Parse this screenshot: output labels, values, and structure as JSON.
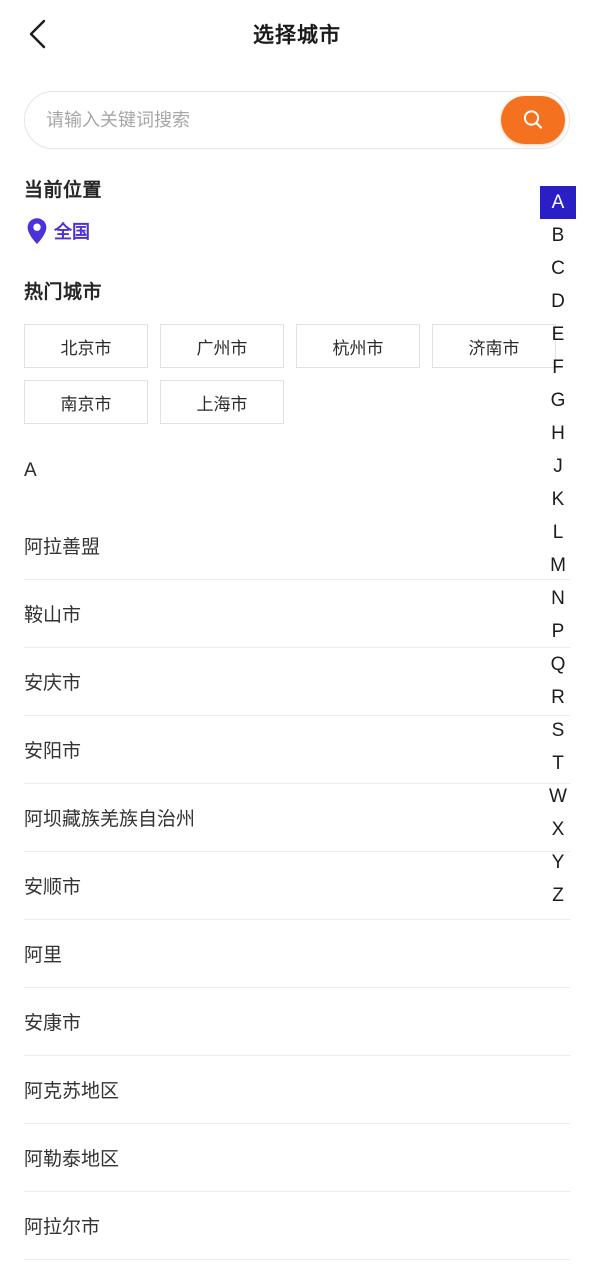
{
  "header": {
    "title": "选择城市",
    "back_icon": "chevron-left-icon"
  },
  "search": {
    "placeholder": "请输入关键词搜索",
    "value": "",
    "button_icon": "search-icon",
    "button_color": "#f4711f"
  },
  "current_location": {
    "section_title": "当前位置",
    "pin_icon": "location-pin-icon",
    "name": "全国",
    "color": "#4b32d8"
  },
  "hot_cities": {
    "section_title": "热门城市",
    "items": [
      {
        "label": "北京市"
      },
      {
        "label": "广州市"
      },
      {
        "label": "杭州市"
      },
      {
        "label": "济南市"
      },
      {
        "label": "南京市"
      },
      {
        "label": "上海市"
      }
    ]
  },
  "city_sections": [
    {
      "letter": "A",
      "cities": [
        {
          "name": "阿拉善盟"
        },
        {
          "name": "鞍山市"
        },
        {
          "name": "安庆市"
        },
        {
          "name": "安阳市"
        },
        {
          "name": "阿坝藏族羌族自治州"
        },
        {
          "name": "安顺市"
        },
        {
          "name": "阿里"
        },
        {
          "name": "安康市"
        },
        {
          "name": "阿克苏地区"
        },
        {
          "name": "阿勒泰地区"
        },
        {
          "name": "阿拉尔市"
        }
      ]
    }
  ],
  "index_bar": {
    "active": "A",
    "active_color": "#2a1fc4",
    "letters": [
      "A",
      "B",
      "C",
      "D",
      "E",
      "F",
      "G",
      "H",
      "J",
      "K",
      "L",
      "M",
      "N",
      "P",
      "Q",
      "R",
      "S",
      "T",
      "W",
      "X",
      "Y",
      "Z"
    ]
  }
}
